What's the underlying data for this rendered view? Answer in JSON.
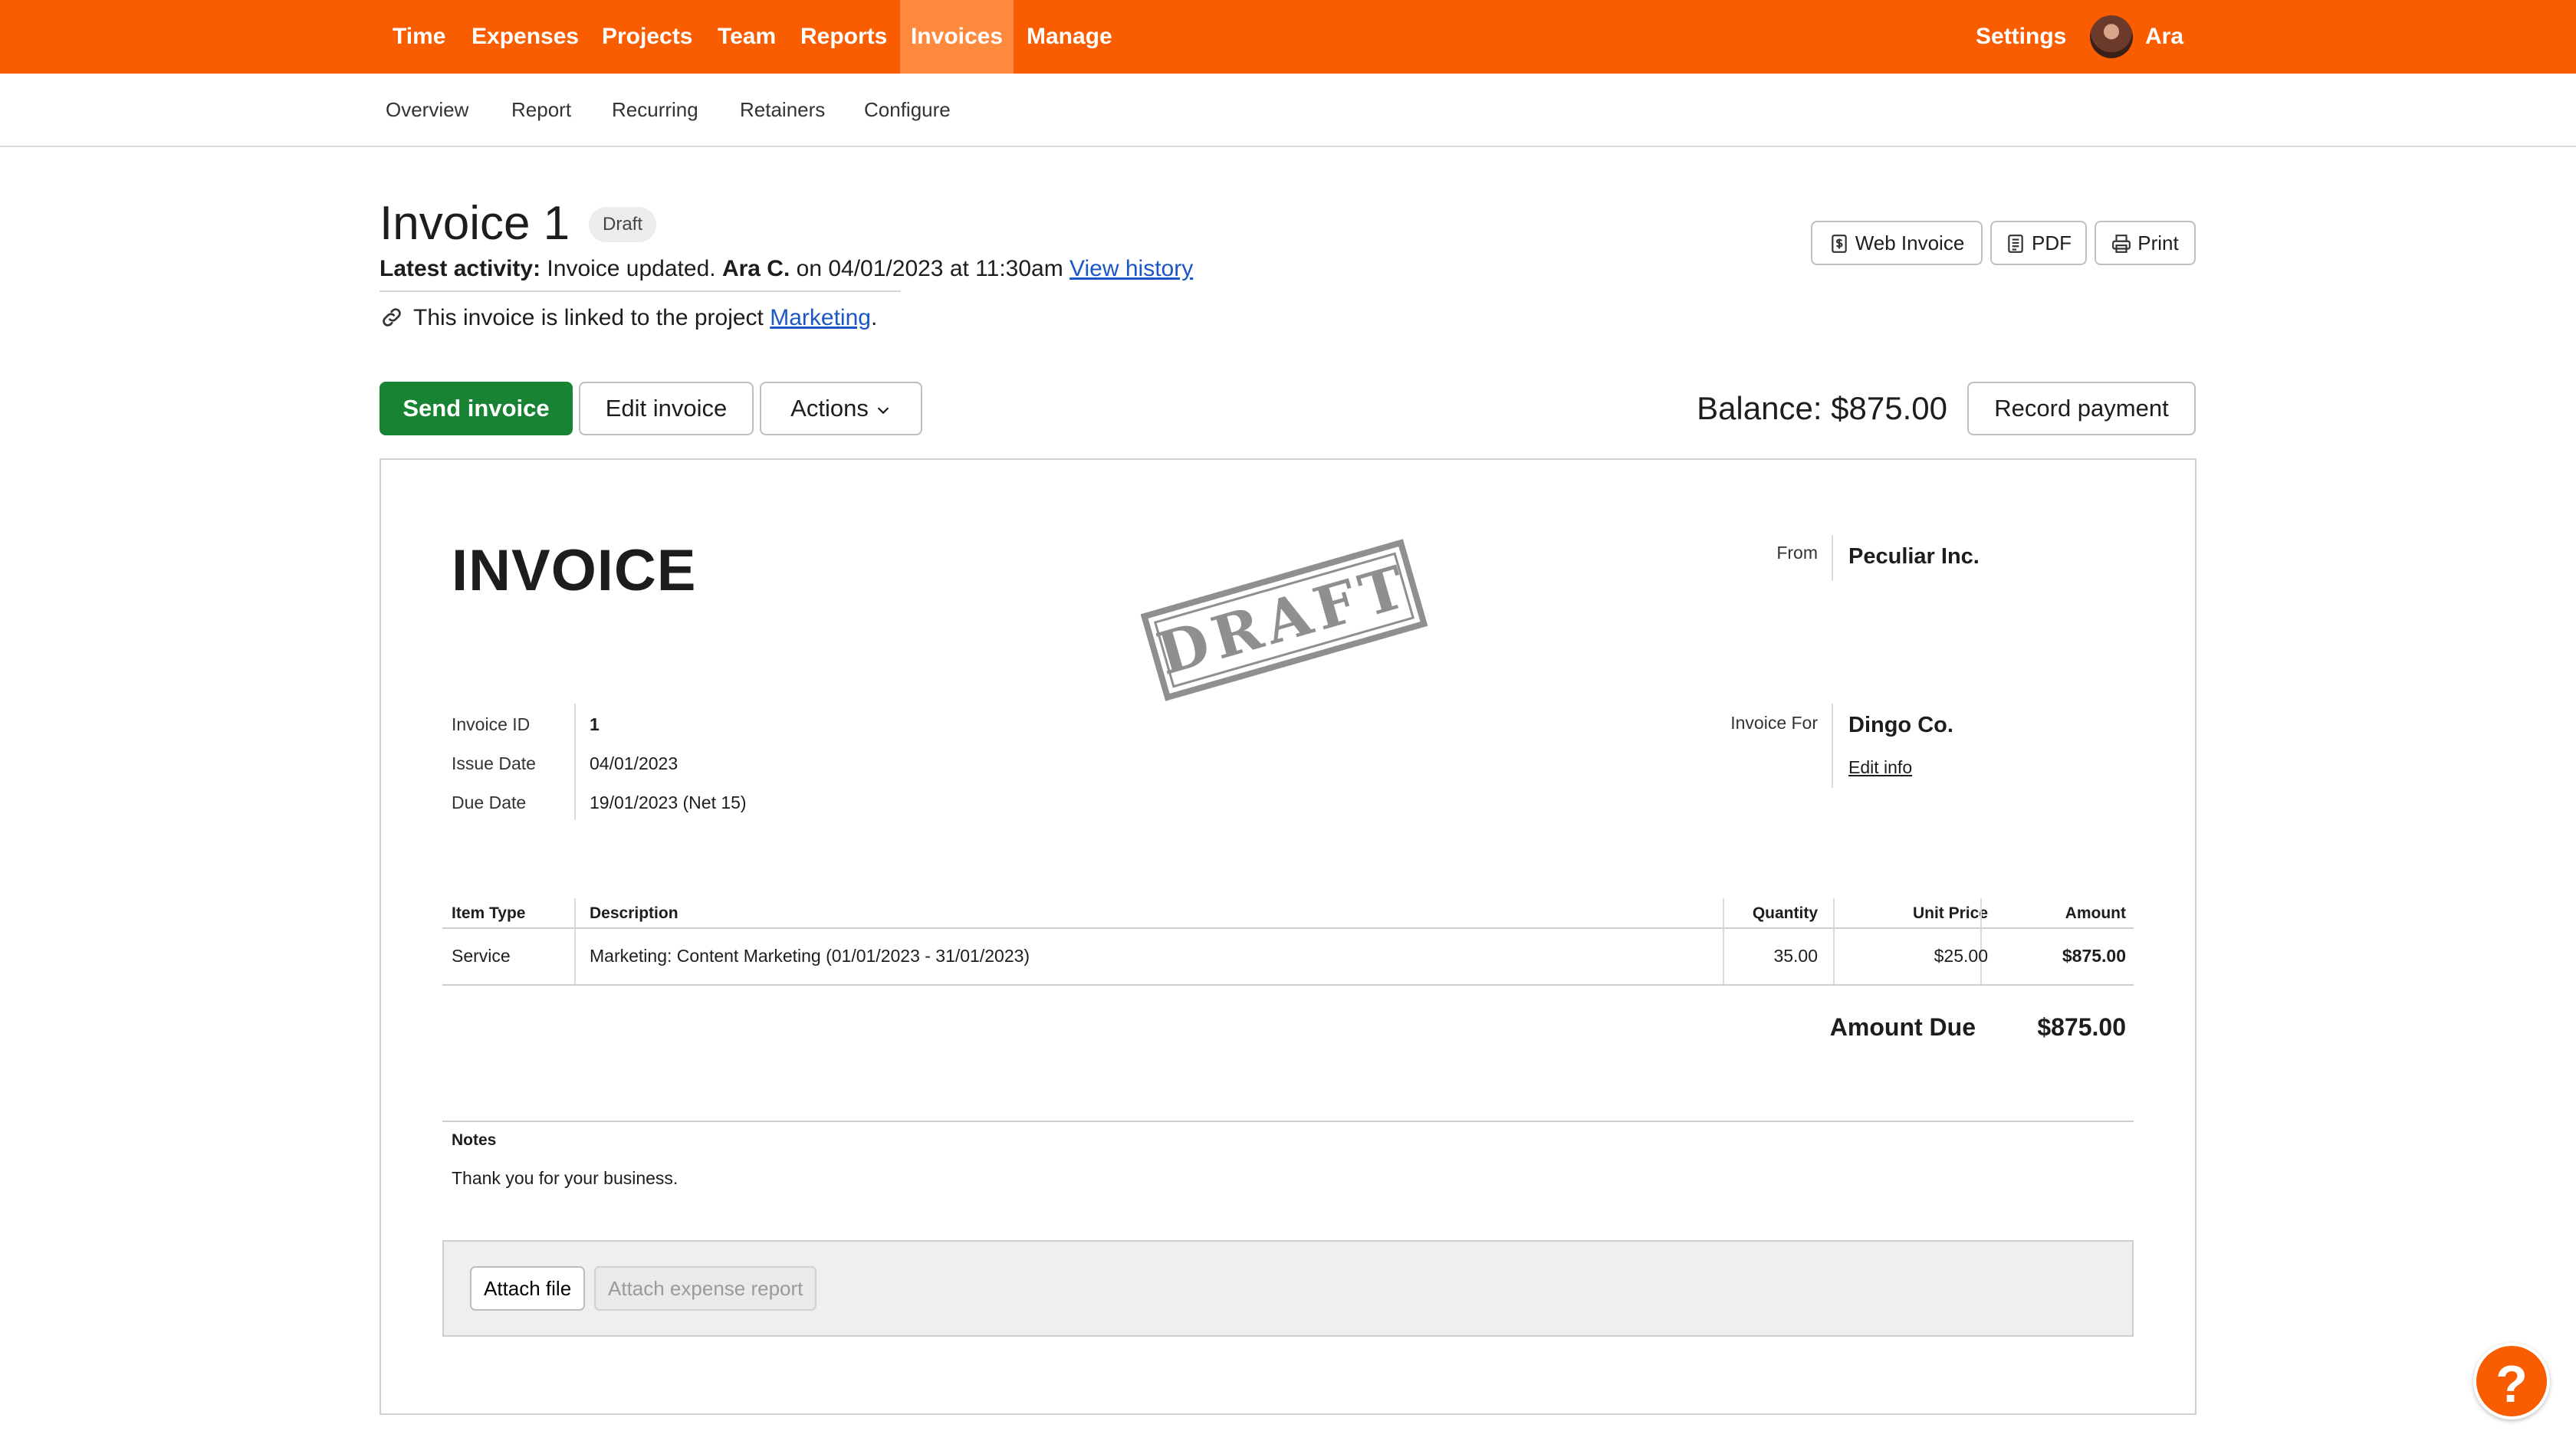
{
  "nav": {
    "items": [
      {
        "label": "Time"
      },
      {
        "label": "Expenses"
      },
      {
        "label": "Projects"
      },
      {
        "label": "Team"
      },
      {
        "label": "Reports"
      },
      {
        "label": "Invoices"
      },
      {
        "label": "Manage"
      }
    ],
    "active": "Invoices",
    "settings_label": "Settings",
    "user_name": "Ara"
  },
  "subnav": {
    "items": [
      {
        "label": "Overview"
      },
      {
        "label": "Report"
      },
      {
        "label": "Recurring"
      },
      {
        "label": "Retainers"
      },
      {
        "label": "Configure"
      }
    ]
  },
  "header": {
    "title": "Invoice 1",
    "status_badge": "Draft",
    "activity_label": "Latest activity:",
    "activity_text": "Invoice updated.",
    "activity_user": "Ara C.",
    "activity_on": "on 04/01/2023 at 11:30am",
    "view_history_label": "View history",
    "linked_prefix": "This invoice is linked to the project",
    "linked_project": "Marketing",
    "linked_suffix": ".",
    "web_invoice_label": "Web Invoice",
    "pdf_label": "PDF",
    "print_label": "Print"
  },
  "actions": {
    "send_label": "Send invoice",
    "edit_label": "Edit invoice",
    "actions_label": "Actions",
    "balance_label": "Balance: $875.00",
    "record_payment_label": "Record payment"
  },
  "invoice": {
    "heading": "INVOICE",
    "stamp": "DRAFT",
    "from_label": "From",
    "from_name": "Peculiar Inc.",
    "for_label": "Invoice For",
    "for_name": "Dingo Co.",
    "edit_info_label": "Edit info",
    "fields": [
      {
        "label": "Invoice ID",
        "value": "1"
      },
      {
        "label": "Issue Date",
        "value": "04/01/2023"
      },
      {
        "label": "Due Date",
        "value": "19/01/2023 (Net 15)"
      }
    ],
    "columns": {
      "item_type": "Item Type",
      "description": "Description",
      "quantity": "Quantity",
      "unit_price": "Unit Price",
      "amount": "Amount"
    },
    "rows": [
      {
        "item_type": "Service",
        "description": "Marketing: Content Marketing (01/01/2023 - 31/01/2023)",
        "quantity": "35.00",
        "unit_price": "$25.00",
        "amount": "$875.00"
      }
    ],
    "amount_due_label": "Amount Due",
    "amount_due_value": "$875.00",
    "notes_label": "Notes",
    "notes_text": "Thank you for your business.",
    "attach_file_label": "Attach file",
    "attach_expense_label": "Attach expense report"
  },
  "help_label": "?",
  "colors": {
    "brand": "#fa5d00",
    "nav_active": "#ff8a3d",
    "primary": "#188433",
    "link": "#1a56c4"
  }
}
